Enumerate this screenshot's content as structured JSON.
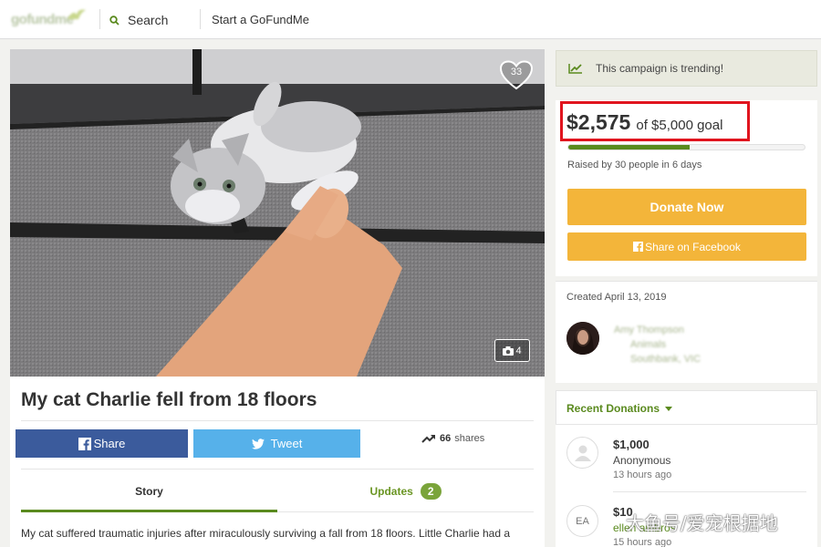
{
  "header": {
    "logo_text": "gofundme",
    "search_label": "Search",
    "start_label": "Start a GoFundMe"
  },
  "hero": {
    "heart_count": "33",
    "photo_count": "4"
  },
  "campaign": {
    "title": "My cat Charlie fell from 18 floors",
    "story_snippet": "My cat suffered traumatic injuries after miraculously surviving a fall from 18 floors. Little Charlie had a"
  },
  "social": {
    "share_label": "Share",
    "tweet_label": "Tweet",
    "shares_count": "66",
    "shares_label": "shares"
  },
  "tabs": {
    "story_label": "Story",
    "updates_label": "Updates",
    "updates_count": "2"
  },
  "funding": {
    "trending_label": "This campaign is trending!",
    "raised": "$2,575",
    "goal_text": "of $5,000 goal",
    "progress_fraction": 0.515,
    "byline": "Raised by 30 people in 6 days",
    "donate_label": "Donate Now",
    "facebook_label": "Share on Facebook"
  },
  "organizer": {
    "created": "Created April 13, 2019",
    "name": "Amy Thompson",
    "category": "Animals",
    "location": "Southbank, VIC"
  },
  "donations": {
    "header_label": "Recent Donations",
    "items": [
      {
        "amount": "$1,000",
        "name": "Anonymous",
        "time": "13 hours ago",
        "initials": ""
      },
      {
        "amount": "$10",
        "name": "ellen ambros",
        "time": "15 hours ago",
        "initials": "EA"
      }
    ]
  },
  "watermark": "大鱼号/爱宠根据地",
  "colors": {
    "brand_green": "#5a8a1e",
    "donate_orange": "#f3b53a",
    "facebook_blue": "#3b5b9c",
    "twitter_blue": "#56b1ea",
    "highlight_red": "#e0141e"
  }
}
